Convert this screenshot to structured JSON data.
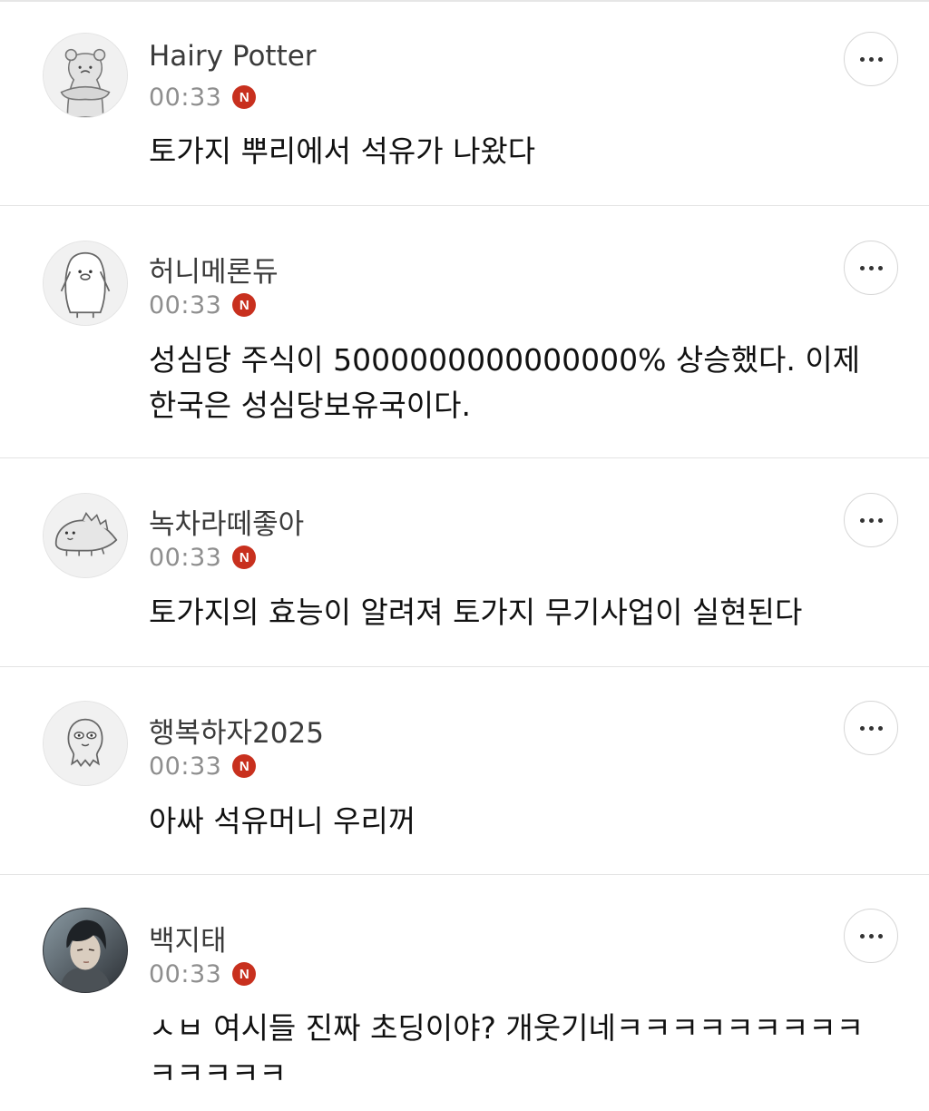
{
  "badge_letter": "N",
  "comments": [
    {
      "author": "Hairy Potter",
      "time": "00:33",
      "text": "토가지 뿌리에서 석유가 나왔다",
      "avatar_icon": "hamster-icon"
    },
    {
      "author": "허니메론듀",
      "time": "00:33",
      "text": "성심당 주식이 5000000000000000% 상승했다. 이제 한국은 성심당보유국이다.",
      "avatar_icon": "penguin-icon"
    },
    {
      "author": "녹차라떼좋아",
      "time": "00:33",
      "text": "토가지의 효능이 알려져 토가지 무기사업이 실현된다",
      "avatar_icon": "dinosaur-icon"
    },
    {
      "author": "행복하자2025",
      "time": "00:33",
      "text": "아싸 석유머니 우리꺼",
      "avatar_icon": "octopus-icon"
    },
    {
      "author": "백지태",
      "time": "00:33",
      "text": "ㅅㅂ 여시들 진짜 초딩이야? 개웃기네ㅋㅋㅋㅋㅋㅋㅋㅋㅋ ㅋㅋㅋㅋㅋ",
      "avatar_icon": "profile-photo"
    }
  ]
}
